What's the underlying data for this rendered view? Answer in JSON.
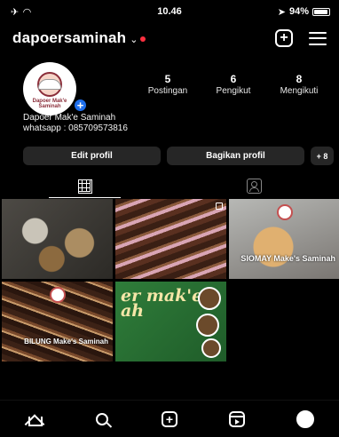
{
  "status_bar": {
    "time": "10.46",
    "battery": "94%"
  },
  "header": {
    "username": "dapoersaminah"
  },
  "profile": {
    "avatar_label": "Dapoer Mak'e Saminah",
    "stats": [
      {
        "count": "5",
        "label": "Postingan"
      },
      {
        "count": "6",
        "label": "Pengikut"
      },
      {
        "count": "8",
        "label": "Mengikuti"
      }
    ],
    "bio_name": "Dapoer Mak'e Saminah",
    "bio_text": "whatsapp : 085709573816"
  },
  "buttons": {
    "edit": "Edit profil",
    "share": "Bagikan profil",
    "discover": "+ 8"
  },
  "posts": [
    {
      "caption": ""
    },
    {
      "caption": ""
    },
    {
      "caption": "SIOMAY Make's Saminah"
    },
    {
      "caption": "BILUNG Make's Saminah"
    },
    {
      "caption": "er mak'e ah"
    }
  ],
  "icons": {
    "grid_tab": "grid-icon",
    "tagged_tab": "tagged-icon",
    "home": "home-icon",
    "search": "search-icon",
    "create": "add-icon",
    "reels": "reels-icon",
    "profile": "profile-icon"
  }
}
